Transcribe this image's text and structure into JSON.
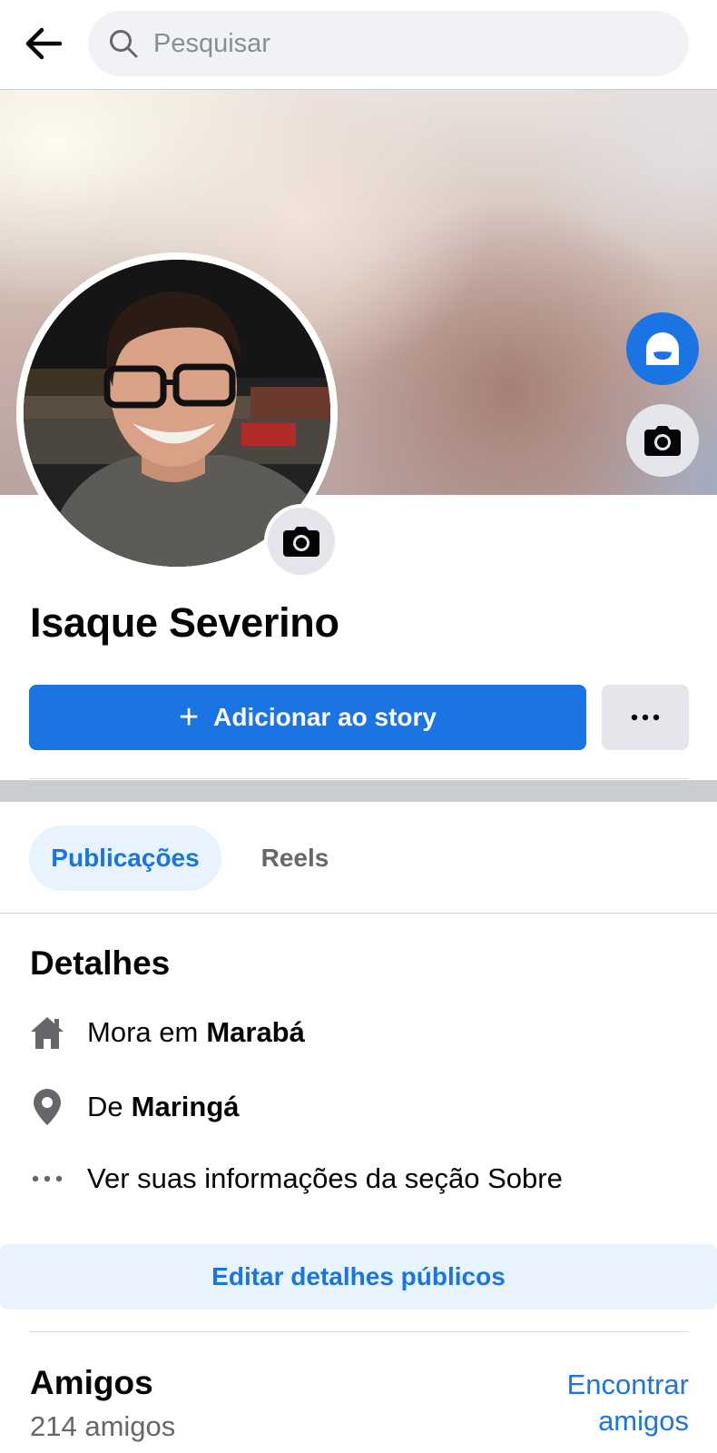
{
  "search": {
    "placeholder": "Pesquisar"
  },
  "profile": {
    "name": "Isaque Severino",
    "add_story_plus": "+",
    "add_story_label": "Adicionar ao story"
  },
  "tabs": [
    {
      "label": "Publicações",
      "active": true
    },
    {
      "label": "Reels",
      "active": false
    }
  ],
  "details": {
    "title": "Detalhes",
    "lives_prefix": "Mora em",
    "lives_city": "Marabá",
    "from_prefix": "De",
    "from_city": "Maringá",
    "about_link": "Ver suas informações da seção Sobre",
    "edit_button": "Editar detalhes públicos"
  },
  "friends": {
    "title": "Amigos",
    "count": "214 amigos",
    "find_line1": "Encontrar",
    "find_line2": "amigos"
  },
  "colors": {
    "accent": "#1b74e4",
    "accent_light": "#e7f3ff",
    "button_gray": "#e4e6eb",
    "secondary_text": "#65676b"
  },
  "icons": [
    "back-arrow-icon",
    "search-icon",
    "avatar-icon",
    "camera-icon",
    "more-dots-icon",
    "home-icon",
    "location-pin-icon",
    "dots-icon"
  ]
}
